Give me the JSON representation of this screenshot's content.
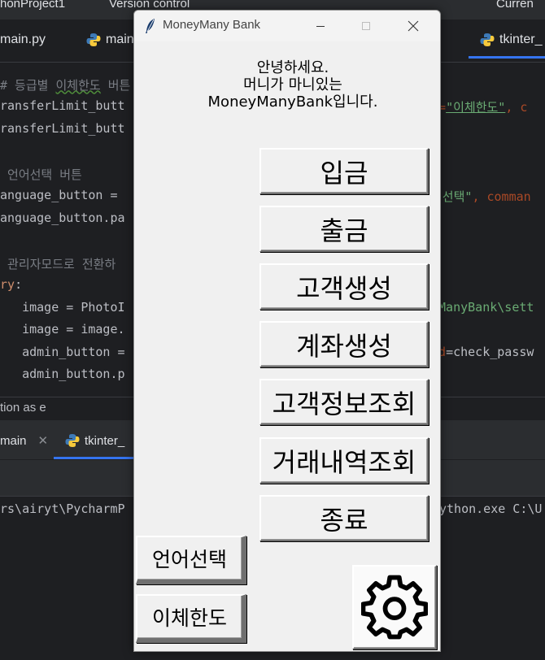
{
  "ide": {
    "menubar": {
      "project": "honProject1",
      "vcs": "Version control",
      "branch": "Curren"
    },
    "tabs": [
      {
        "label": "main.py"
      },
      {
        "label": "main"
      },
      {
        "label": "tkinter_"
      }
    ],
    "code_lines": [
      {
        "text": "",
        "seg": []
      },
      {
        "seg": [
          {
            "t": "# 등급별 ",
            "c": "cm"
          },
          {
            "t": "이체한도",
            "c": "cm u"
          },
          {
            "t": " 버튼",
            "c": "cm"
          }
        ]
      },
      {
        "seg": [
          {
            "t": "ransferLimit_butt",
            "c": ""
          }
        ]
      },
      {
        "seg": [
          {
            "t": "ransferLimit_butt",
            "c": ""
          }
        ]
      },
      {
        "seg": []
      },
      {
        "seg": [
          {
            "t": " 언어선택 버튼",
            "c": "cm"
          }
        ]
      },
      {
        "seg": [
          {
            "t": "anguage_button = ",
            "c": ""
          }
        ]
      },
      {
        "seg": [
          {
            "t": "anguage_button.pa",
            "c": ""
          }
        ]
      },
      {
        "seg": []
      },
      {
        "seg": [
          {
            "t": " 관리자모드로 전환하",
            "c": "cm"
          }
        ]
      },
      {
        "seg": [
          {
            "t": "ry",
            "c": "kw"
          },
          {
            "t": ":",
            "c": ""
          }
        ]
      },
      {
        "seg": [
          {
            "t": "   image = PhotoI",
            "c": ""
          }
        ]
      },
      {
        "seg": [
          {
            "t": "   image = image.",
            "c": ""
          }
        ]
      },
      {
        "seg": [
          {
            "t": "   admin_button =",
            "c": ""
          }
        ]
      },
      {
        "seg": [
          {
            "t": "   admin_button.p",
            "c": ""
          }
        ]
      }
    ],
    "code_right": [
      {
        "seg": [
          {
            "t": "t=",
            "c": "arg"
          },
          {
            "t": "\"이체한도\"",
            "c": "str2"
          },
          {
            "t": ", c",
            "c": "arg"
          }
        ]
      },
      {
        "seg": [
          {
            "t": "어선택\"",
            "c": "str"
          },
          {
            "t": ", comman",
            "c": "arg"
          }
        ]
      },
      {
        "seg": [
          {
            "t": "yManyBank\\sett",
            "c": "str"
          }
        ]
      },
      {
        "seg": [
          {
            "t": "nd",
            "c": "arg"
          },
          {
            "t": "=check_passw",
            "c": ""
          }
        ]
      }
    ],
    "status_line": "tion as e",
    "run_tabs": [
      {
        "label": "main"
      },
      {
        "label": "tkinter_"
      }
    ],
    "console_left": "rs\\airyt\\PycharmP",
    "console_right": "ython.exe C:\\U"
  },
  "window": {
    "title": "MoneyMany Bank",
    "icon": "feather-icon",
    "controls": {
      "minimize": "minimize-icon",
      "maximize": "maximize-icon",
      "close": "close-icon"
    }
  },
  "greeting": {
    "line1": "안녕하세요.",
    "line2": "머니가 마니있는",
    "line3": "MoneyManyBank입니다."
  },
  "menu": {
    "deposit": "입금",
    "withdraw": "출금",
    "create_customer": "고객생성",
    "create_account": "계좌생성",
    "customer_info": "고객정보조회",
    "transaction_history": "거래내역조회",
    "exit": "종료"
  },
  "side": {
    "language": "언어선택",
    "transfer_limit": "이체한도"
  },
  "settings": {
    "icon": "gear-icon"
  }
}
